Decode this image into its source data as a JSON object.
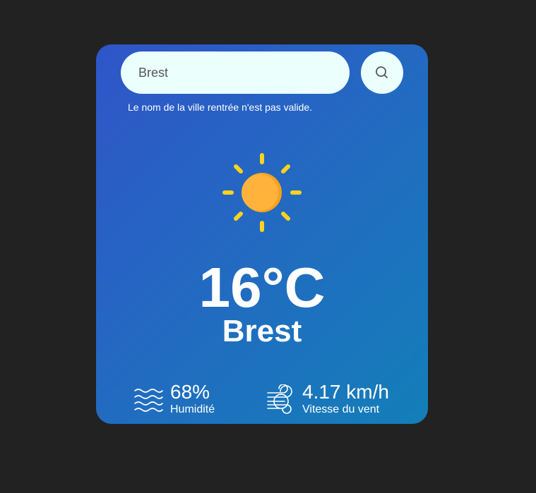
{
  "search": {
    "value": "Brest",
    "placeholder": ""
  },
  "search_button_icon": "search-icon",
  "error_message": "Le nom de la ville rentrée n'est pas valide.",
  "weather_icon": "sun-icon",
  "temperature": "16°C",
  "city": "Brest",
  "humidity": {
    "icon": "waves-icon",
    "value": "68%",
    "label": "Humidité"
  },
  "wind": {
    "icon": "wind-icon",
    "value": "4.17 km/h",
    "label": "Vitesse du vent"
  },
  "colors": {
    "background": "#222222",
    "card_gradient_start": "#2f55c8",
    "card_gradient_end": "#137fb8",
    "input_background": "#ebfffc",
    "sun_rays": "#ffd21f",
    "sun_body": "#ffb23c"
  }
}
